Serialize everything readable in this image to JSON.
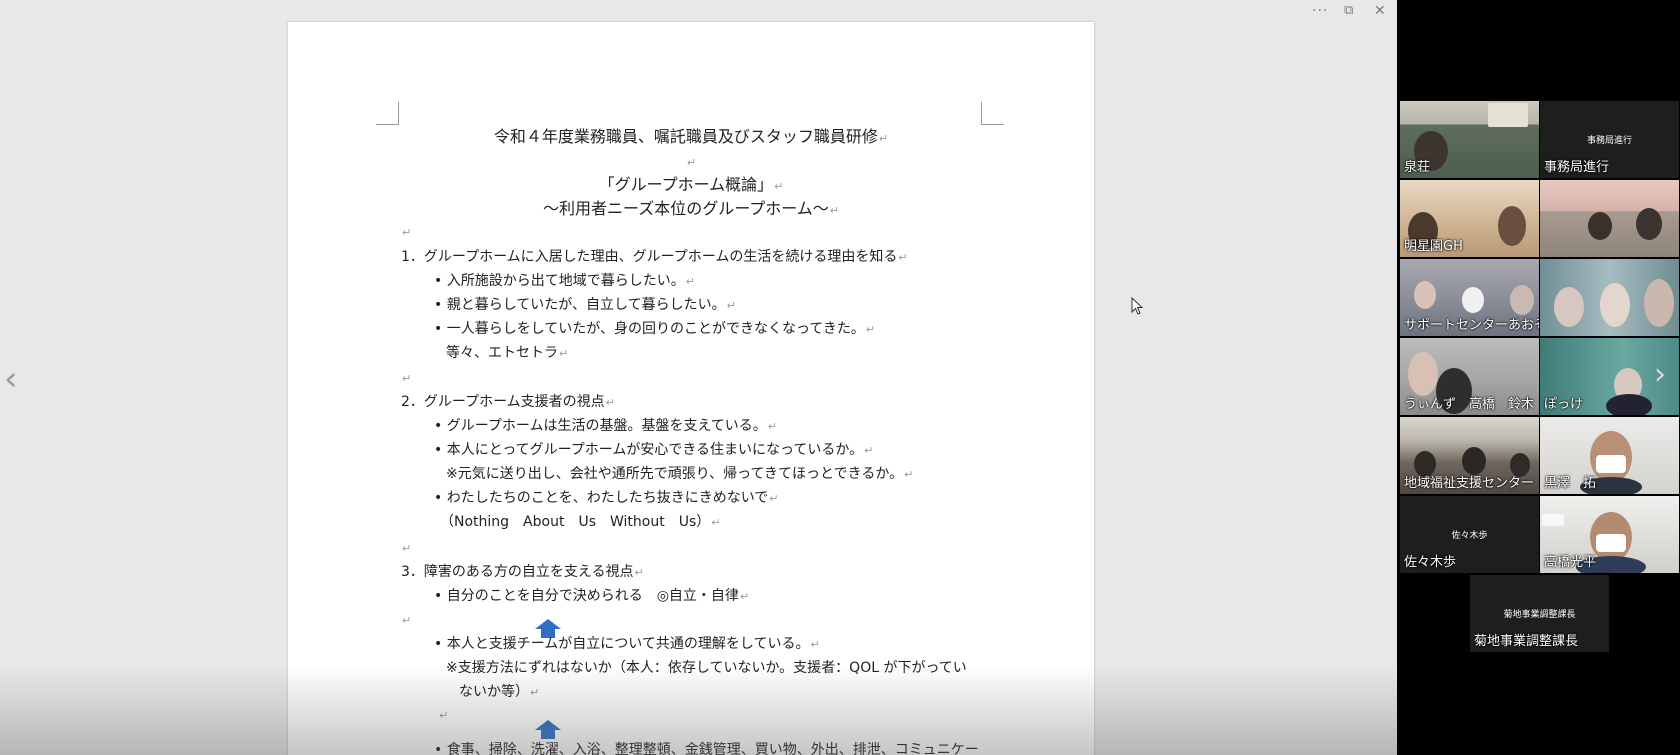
{
  "window_controls": {
    "more": "···",
    "restore": "⧉",
    "close": "✕"
  },
  "document": {
    "title": "令和４年度業務職員、嘱託職員及びスタッフ職員研修",
    "subtitle1": "「グループホーム概論」",
    "subtitle2": "〜利用者ニーズ本位のグループホーム〜",
    "return_mark": "↵",
    "s1_heading": "1．グループホームに入居した理由、グループホームの生活を続ける理由を知る",
    "s1_b1": "• 入所施設から出て地域で暮らしたい。",
    "s1_b2": "• 親と暮らしていたが、自立して暮らしたい。",
    "s1_b3": "• 一人暮らしをしていたが、身の回りのことができなくなってきた。",
    "s1_etc": "等々、エトセトラ",
    "s2_heading": "2．グループホーム支援者の視点",
    "s2_b1": "• グループホームは生活の基盤。基盤を支えている。",
    "s2_b2": "• 本人にとってグループホームが安心できる住まいになっているか。",
    "s2_b2_note": "※元気に送り出し、会社や通所先で頑張り、帰ってきてほっとできるか。",
    "s2_b3": "• わたしたちのことを、わたしたち抜きにきめないで",
    "s2_b3_en": "（Nothing　About　Us　Without　Us）",
    "s3_heading": "3．障害のある方の自立を支える視点",
    "s3_b1": "• 自分のことを自分で決められる　◎自立・自律",
    "s3_b2": "• 本人と支援チームが自立について共通の理解をしている。",
    "s3_b2_note1": "※支援方法にずれはないか（本人：依存していないか。支援者：QOL が下がってい",
    "s3_b2_note2": "ないか等）",
    "s3_b3": "• 食事、掃除、洗濯、入浴、整理整頓、金銭管理、買い物、外出、排泄、コミュニケー"
  },
  "nav": {
    "left": "‹",
    "right": "›"
  },
  "participants": [
    {
      "name": "泉荘"
    },
    {
      "name": "事務局進行",
      "center_text": "事務局進行"
    },
    {
      "name": "明星園GH"
    },
    {
      "name": ""
    },
    {
      "name": "サポートセンターあおぞら"
    },
    {
      "name": ""
    },
    {
      "name": "うぃんず　高橋　鈴木"
    },
    {
      "name": "ぽっけ"
    },
    {
      "name": "地域福祉支援センター"
    },
    {
      "name": "黒澤　拓"
    },
    {
      "name": "佐々木歩",
      "center_text": "佐々木歩"
    },
    {
      "name": "高橋光平"
    },
    {
      "name": "菊地事業調整課長",
      "center_text": "菊地事業調整課長"
    }
  ],
  "colors": {
    "arrow": "#2f6fc4",
    "share_bg": "#e8e8e8"
  }
}
